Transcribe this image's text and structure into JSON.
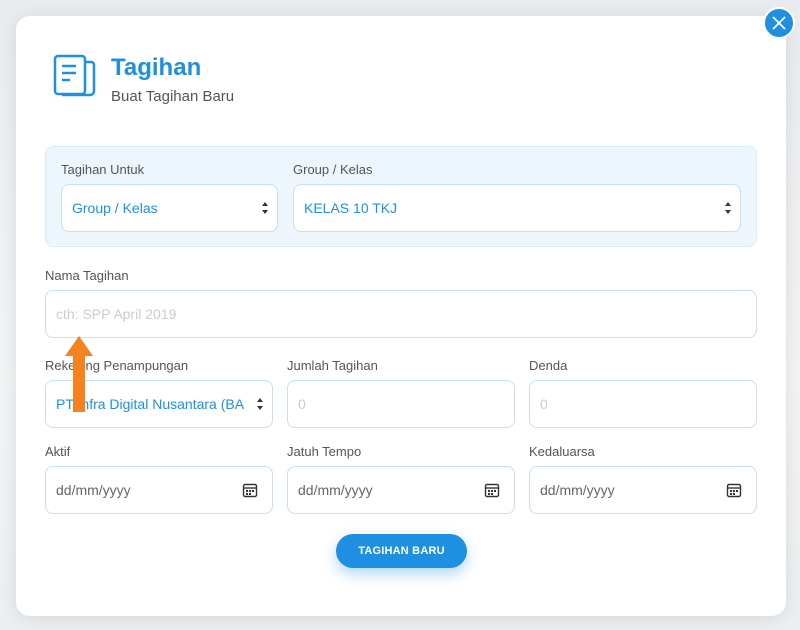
{
  "header": {
    "title": "Tagihan",
    "subtitle": "Buat Tagihan Baru"
  },
  "form": {
    "tagihan_untuk": {
      "label": "Tagihan Untuk",
      "value": "Group / Kelas"
    },
    "group_kelas": {
      "label": "Group / Kelas",
      "value": "KELAS 10 TKJ"
    },
    "nama_tagihan": {
      "label": "Nama Tagihan",
      "placeholder": "cth: SPP April 2019"
    },
    "rekening": {
      "label": "Rekening Penampungan",
      "value": "PT Infra Digital Nusantara (BA"
    },
    "jumlah": {
      "label": "Jumlah Tagihan",
      "placeholder": "0"
    },
    "denda": {
      "label": "Denda",
      "placeholder": "0"
    },
    "aktif": {
      "label": "Aktif",
      "value": "dd/mm/yyyy"
    },
    "jatuh_tempo": {
      "label": "Jatuh Tempo",
      "value": "dd/mm/yyyy"
    },
    "kedaluarsa": {
      "label": "Kedaluarsa",
      "value": "dd/mm/yyyy"
    }
  },
  "submit_label": "TAGIHAN BARU",
  "icons": {
    "header": "receipt-book-icon",
    "close": "close-icon",
    "calendar": "calendar-icon",
    "caret": "select-caret-icon",
    "annotation": "orange-up-arrow"
  },
  "colors": {
    "accent": "#1e8fe1",
    "panel": "#eef6fd",
    "annotation": "#f5811f"
  }
}
